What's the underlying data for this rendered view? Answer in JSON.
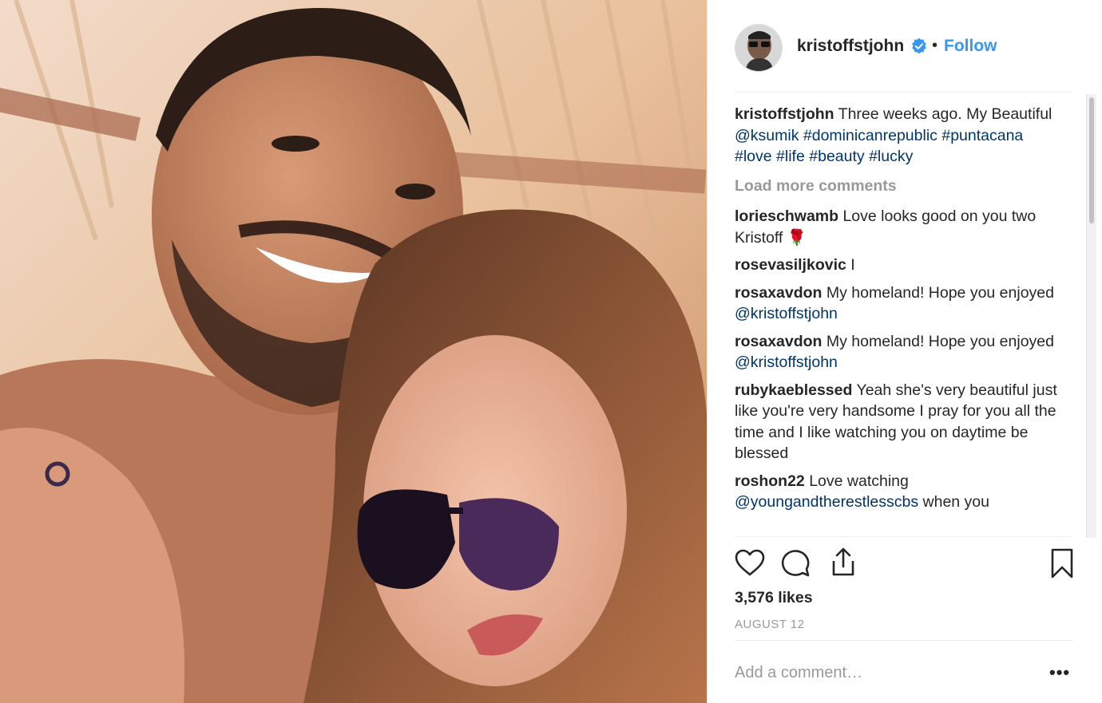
{
  "post": {
    "username": "kristoffstjohn",
    "follow_label": "Follow",
    "dot": "•",
    "caption": {
      "user": "kristoffstjohn",
      "text": " Three weeks ago. My Beautiful ",
      "mention": "@ksumik",
      "hashtags": [
        "#dominicanrepublic",
        "#puntacana",
        "#love",
        "#life",
        "#beauty",
        "#lucky"
      ]
    },
    "load_more": "Load more comments",
    "comments": [
      {
        "user": "lorieschwamb",
        "text": " Love looks good on you two Kristoff 🌹",
        "mention": ""
      },
      {
        "user": "rosevasiljkovic",
        "text": " I",
        "mention": ""
      },
      {
        "user": "rosaxavdon",
        "text": " My homeland! Hope you enjoyed ",
        "mention": "@kristoffstjohn"
      },
      {
        "user": "rosaxavdon",
        "text": " My homeland! Hope you enjoyed ",
        "mention": "@kristoffstjohn"
      },
      {
        "user": "rubykaeblessed",
        "text": " Yeah she's very beautiful just like you're very handsome I pray for you all the time and I like watching you on daytime be blessed",
        "mention": ""
      },
      {
        "user": "roshon22",
        "text": " Love watching ",
        "mention": "@youngandtherestlesscbs",
        "tail": " when you"
      }
    ],
    "likes": "3,576 likes",
    "date": "AUGUST 12",
    "add_comment_placeholder": "Add a comment…",
    "more_label": "•••"
  },
  "icons": [
    "heart-icon",
    "comment-icon",
    "share-icon",
    "bookmark-icon",
    "verified-badge-icon"
  ],
  "colors": {
    "follow": "#3897f0",
    "link": "#003569",
    "muted": "#999999"
  }
}
